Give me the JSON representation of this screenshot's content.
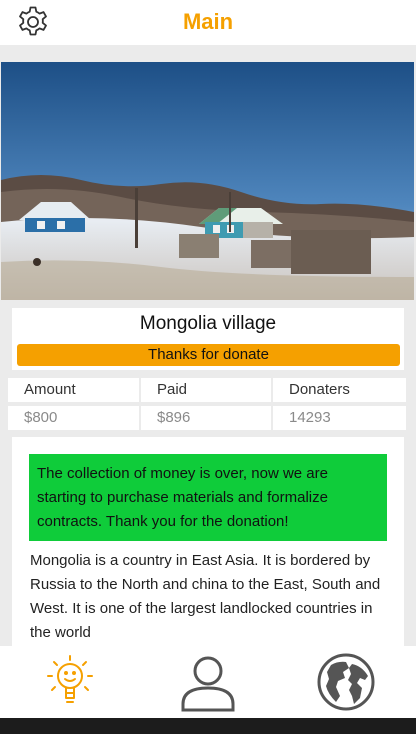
{
  "header": {
    "title": "Main",
    "settings_icon": "gear-icon"
  },
  "hero": {
    "image": "snowy-village-photo"
  },
  "project": {
    "name": "Mongolia village",
    "status_label": "Thanks for donate"
  },
  "stats": {
    "headers": [
      "Amount",
      "Paid",
      "Donaters"
    ],
    "values": [
      "$800",
      "$896",
      "14293"
    ]
  },
  "content": {
    "notice": "The collection of money is over, now we are starting to purchase materials and formalize contracts. Thank you for the donation!",
    "description": "Mongolia is a country in East Asia. It is bordered by Russia to the North and china to the East, South and West. It is one of the largest landlocked countries in the world"
  },
  "nav": {
    "items": [
      {
        "icon": "lightbulb-icon",
        "active": true
      },
      {
        "icon": "user-icon",
        "active": false
      },
      {
        "icon": "globe-icon",
        "active": false
      }
    ]
  },
  "colors": {
    "accent": "#f5a000",
    "notice_green": "#0fcc3a",
    "icon_gray": "#555555"
  }
}
